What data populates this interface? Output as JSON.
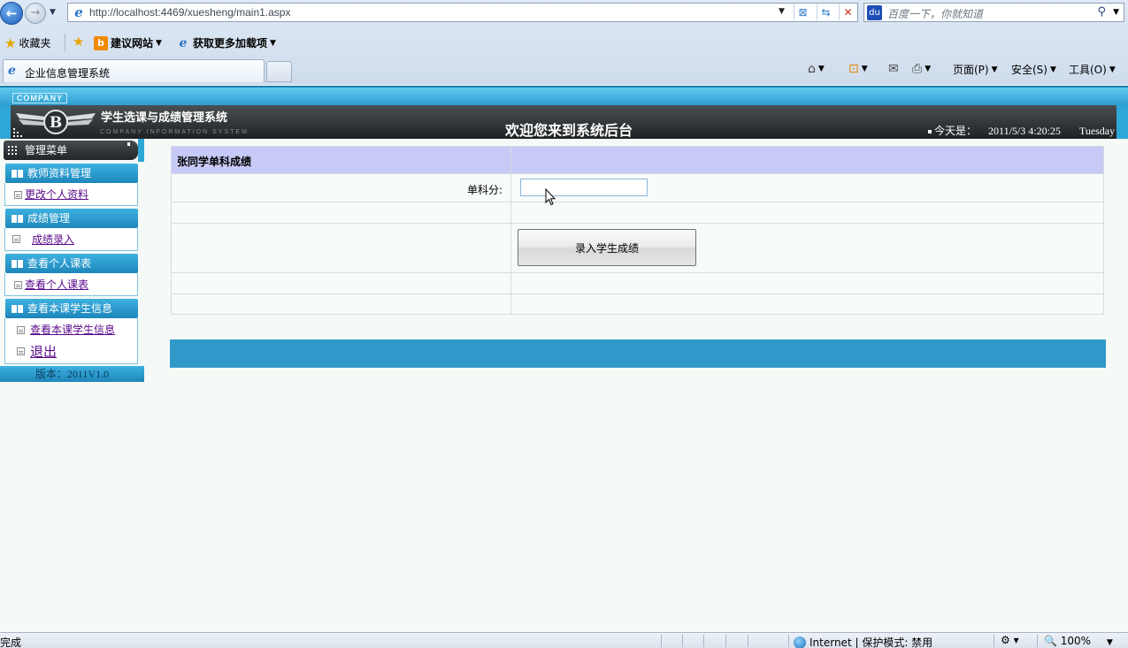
{
  "browser": {
    "url": "http://localhost:4469/xuesheng/main1.aspx",
    "search_placeholder": "百度一下，你就知道",
    "favorites_label": "收藏夹",
    "suggested_sites": "建议网站",
    "more_addons": "获取更多加载项",
    "tab_title": "企业信息管理系统",
    "page_menu": "页面(P)",
    "safety_menu": "安全(S)",
    "tools_menu": "工具(O)",
    "status_text": "完成",
    "zone_text": "Internet | 保护模式: 禁用",
    "zoom": "100%"
  },
  "header": {
    "company_tag": "COMPANY",
    "system_title": "学生选课与成绩管理系统",
    "system_subtitle": "COMPANY INFORMATION SYSTEM",
    "welcome": "欢迎您来到系统后台",
    "today_label": "今天是：",
    "datetime": "2011/5/3 4:20:25",
    "weekday": "Tuesday"
  },
  "sidebar": {
    "title": "管理菜单",
    "sections": [
      {
        "title": "教师资料管理",
        "items": [
          "更改个人资料"
        ]
      },
      {
        "title": "成绩管理",
        "items": [
          "成绩录入"
        ]
      },
      {
        "title": "查看个人课表",
        "items": [
          "查看个人课表"
        ]
      },
      {
        "title": "查看本课学生信息",
        "items": [
          "查看本课学生信息",
          "退出"
        ]
      }
    ],
    "version": "版本：2011V1.0"
  },
  "form": {
    "title": "张同学单科成绩",
    "score_label": "单科分:",
    "score_value": "",
    "submit_label": "录入学生成绩"
  },
  "colors": {
    "accent_blue": "#3199c9",
    "form_header": "#c7caf6",
    "link_purple": "#5a0a8a"
  }
}
